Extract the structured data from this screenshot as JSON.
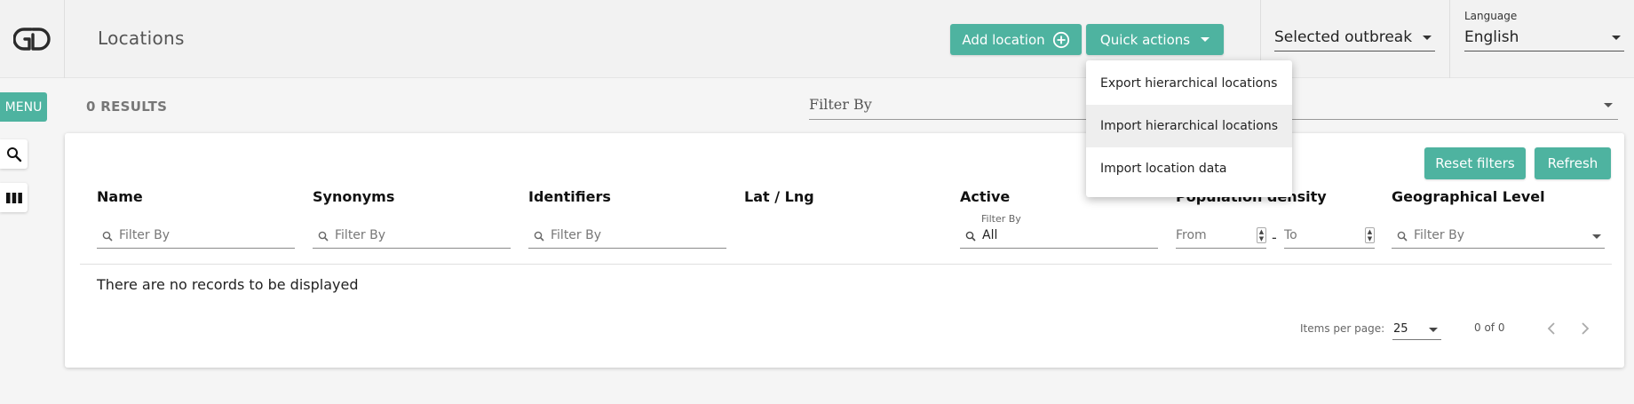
{
  "header": {
    "logo_icon": "go-data-logo-icon",
    "title": "Locations",
    "add_location_label": "Add location",
    "quick_actions_label": "Quick actions",
    "outbreak_select_value": "Selected outbreak",
    "language_label": "Language",
    "language_value": "English"
  },
  "quick_actions_menu": {
    "items": [
      {
        "label": "Export hierarchical locations",
        "highlighted": false
      },
      {
        "label": "Import hierarchical locations",
        "highlighted": true
      },
      {
        "label": "Import location data",
        "highlighted": false
      }
    ]
  },
  "sidebar": {
    "menu_label": "MENU",
    "icons": [
      "search-icon",
      "columns-icon"
    ]
  },
  "toolbar": {
    "results_label": "0 RESULTS",
    "filter_placeholder": "Filter By"
  },
  "table": {
    "reset_filters_label": "Reset filters",
    "refresh_label": "Refresh",
    "columns": {
      "name": "Name",
      "synonyms": "Synonyms",
      "identifiers": "Identifiers",
      "latlng": "Lat / Lng",
      "active": "Active",
      "population_density": "Population density",
      "geographical_level": "Geographical Level"
    },
    "filters": {
      "placeholder": "Filter By",
      "active_label": "Filter By",
      "active_value": "All",
      "from_placeholder": "From",
      "to_placeholder": "To",
      "range_separator": "-"
    },
    "empty_message": "There are no records to be displayed"
  },
  "pagination": {
    "items_per_page_label": "Items per page:",
    "items_per_page_value": "25",
    "range_label": "0 of 0"
  },
  "colors": {
    "accent": "#4eb3a0",
    "background": "#f5f5f5"
  }
}
